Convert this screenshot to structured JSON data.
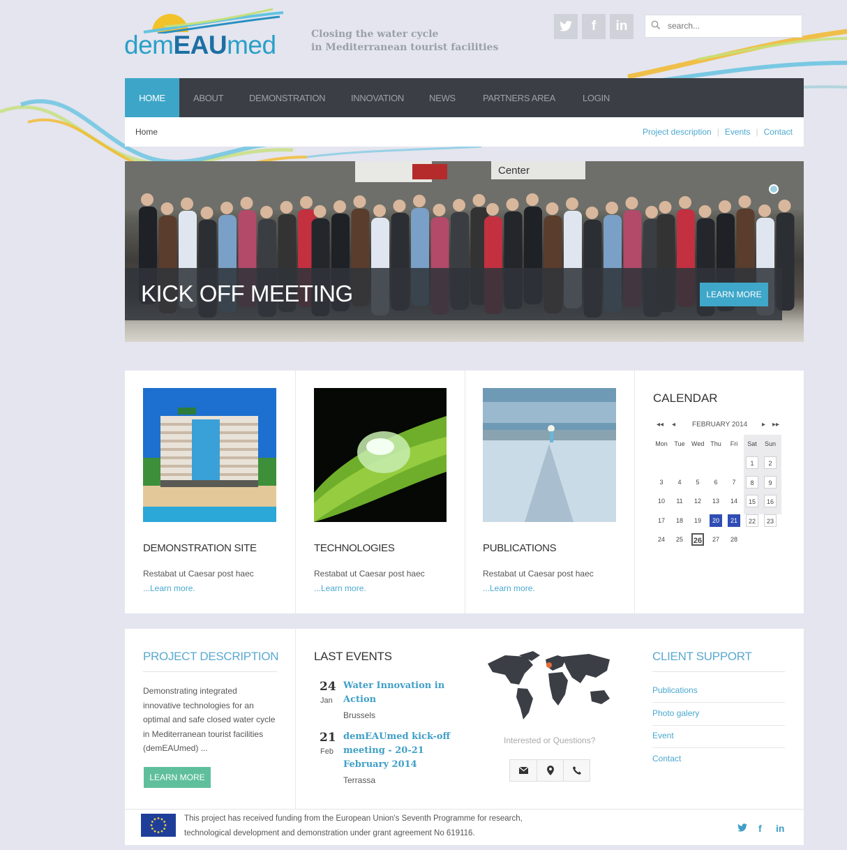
{
  "brand": {
    "logo_prefix": "dem",
    "logo_bold": "EAU",
    "logo_suffix": "med",
    "tagline_line1": "Closing the water cycle",
    "tagline_line2": "in Mediterranean tourist facilities"
  },
  "social": {
    "twitter": "y",
    "facebook": "f",
    "linkedin": "in"
  },
  "search": {
    "placeholder": "search..."
  },
  "nav": {
    "items": [
      "HOME",
      "ABOUT",
      "DEMONSTRATION",
      "INNOVATION",
      "NEWS",
      "PARTNERS AREA",
      "LOGIN"
    ],
    "active": "HOME"
  },
  "breadcrumb": {
    "current": "Home",
    "links": [
      "Project description",
      "Events",
      "Contact"
    ]
  },
  "hero": {
    "title": "KICK OFF MEETING",
    "button": "LEARN MORE",
    "sign_text": "Center"
  },
  "cards": [
    {
      "title": "DEMONSTRATION SITE",
      "text": "Restabat ut Caesar post haec",
      "more": "...Learn more."
    },
    {
      "title": "TECHNOLOGIES",
      "text": "Restabat ut Caesar post haec",
      "more": "...Learn more."
    },
    {
      "title": "PUBLICATIONS",
      "text": "Restabat ut Caesar post haec",
      "more": "...Learn more."
    }
  ],
  "calendar": {
    "title": "CALENDAR",
    "month": "FEBRUARY 2014",
    "prev_year": "◂◂",
    "prev_month": "◂",
    "next_month": "▸",
    "next_year": "▸▸",
    "weekdays": [
      "Mon",
      "Tue",
      "Wed",
      "Thu",
      "Fri",
      "Sat",
      "Sun"
    ],
    "weeks": [
      [
        "",
        "",
        "",
        "",
        "",
        "1",
        "2"
      ],
      [
        "3",
        "4",
        "5",
        "6",
        "7",
        "8",
        "9"
      ],
      [
        "10",
        "11",
        "12",
        "13",
        "14",
        "15",
        "16"
      ],
      [
        "17",
        "18",
        "19",
        "20",
        "21",
        "22",
        "23"
      ],
      [
        "24",
        "25",
        "26",
        "27",
        "28",
        "",
        ""
      ]
    ],
    "event_days": [
      "20",
      "21"
    ],
    "today": "26"
  },
  "project_description": {
    "title": "PROJECT DESCRIPTION",
    "lines": [
      "Demonstrating integrated",
      "innovative technologies for an",
      "optimal and safe closed water cycle",
      "in Mediterranean tourist facilities",
      "(demEAUmed) ..."
    ],
    "button": "LEARN MORE"
  },
  "last_events": {
    "title": "LAST EVENTS",
    "events": [
      {
        "day": "24",
        "month": "Jan",
        "title_lines": [
          "Water Innovation in",
          "Action"
        ],
        "location": "Brussels"
      },
      {
        "day": "21",
        "month": "Feb",
        "title_lines": [
          "demEAUmed kick-off",
          "meeting - 20-21",
          "February 2014"
        ],
        "location": "Terrassa"
      }
    ]
  },
  "contact": {
    "question": "Interested or Questions?"
  },
  "client_support": {
    "title": "CLIENT SUPPORT",
    "links": [
      "Publications",
      "Photo galery",
      "Event",
      "Contact"
    ]
  },
  "footer": {
    "funding_line1": "This project has received funding from the European Union's Seventh Programme for research,",
    "funding_line2": "technological development and demonstration under grant agreement No 619116."
  },
  "colors": {
    "accent": "#3da6c8",
    "nav_bg": "#3b3f45",
    "green_button": "#5fbf9c",
    "event_highlight": "#2f4db3",
    "page_bg": "#e4e5ef"
  }
}
